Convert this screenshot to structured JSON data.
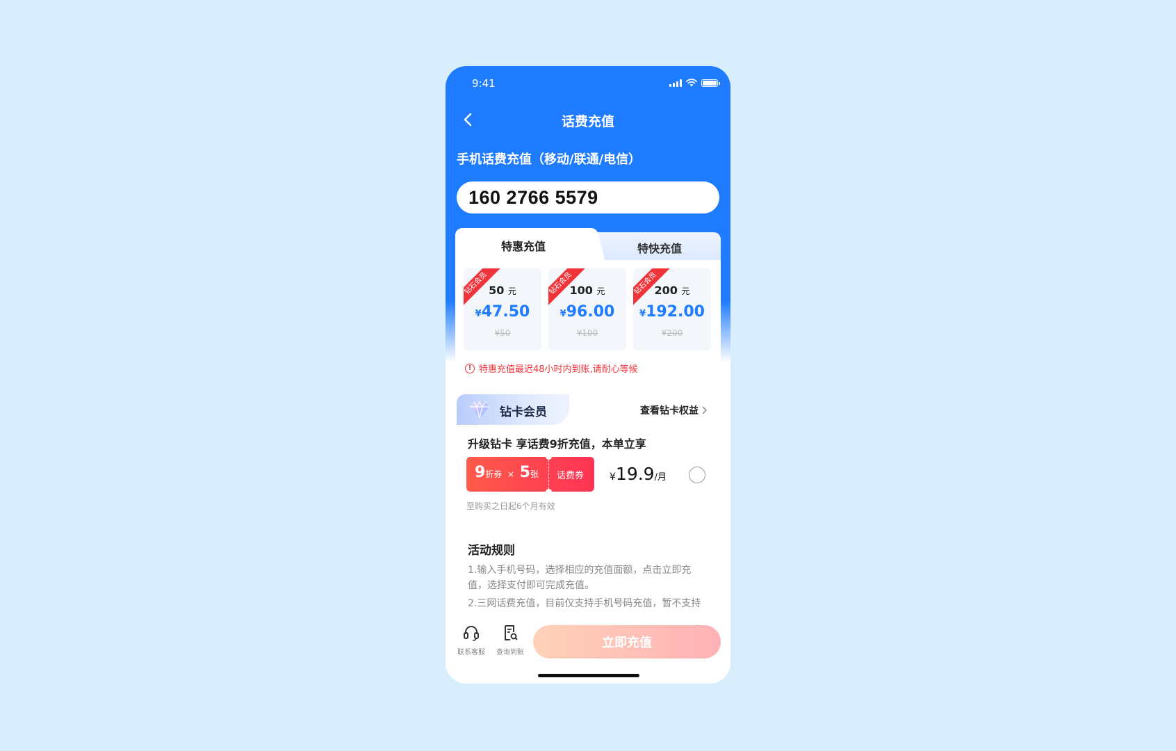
{
  "status": {
    "time": "9:41"
  },
  "nav": {
    "title": "话费充值"
  },
  "heading": "手机话费充值（移动/联通/电信）",
  "phone_number": "160 2766 5579",
  "tabs": {
    "special": "特惠充值",
    "fast": "特快充值"
  },
  "denominations": [
    {
      "ribbon": "钻石会员",
      "face": "50",
      "unit": "元",
      "currency": "¥",
      "price": "47.50",
      "original": "¥50"
    },
    {
      "ribbon": "钻石会员",
      "face": "100",
      "unit": "元",
      "currency": "¥",
      "price": "96.00",
      "original": "¥100"
    },
    {
      "ribbon": "钻石会员",
      "face": "200",
      "unit": "元",
      "currency": "¥",
      "price": "192.00",
      "original": "¥200"
    }
  ],
  "notice": "特惠充值最迟48小时内到账,请耐心等候",
  "member": {
    "title": "钻卡会员",
    "link": "查看钻卡权益",
    "description": "升级钻卡 享话费9折充值，本单立享",
    "coupon": {
      "discount": "9",
      "discount_unit": "折券",
      "times": "×",
      "count": "5",
      "count_unit": "张",
      "type": "话费券"
    },
    "price": {
      "currency": "¥",
      "amount": "19.9",
      "unit": "/月"
    },
    "validity": "至购买之日起6个月有效"
  },
  "rules": {
    "title": "活动规则",
    "items": [
      "1.输入手机号码，选择相应的充值面额，点击立即充值，选择支付即可完成充值。",
      "2.三网话费充值，目前仅支持手机号码充值，暂不支持"
    ]
  },
  "bottom": {
    "service_label": "联系客服",
    "query_label": "查询到账",
    "pay_label": "立即充值"
  },
  "colors": {
    "primary": "#1f7bff",
    "accent_red": "#f0343a",
    "background": "#d8eefc"
  }
}
